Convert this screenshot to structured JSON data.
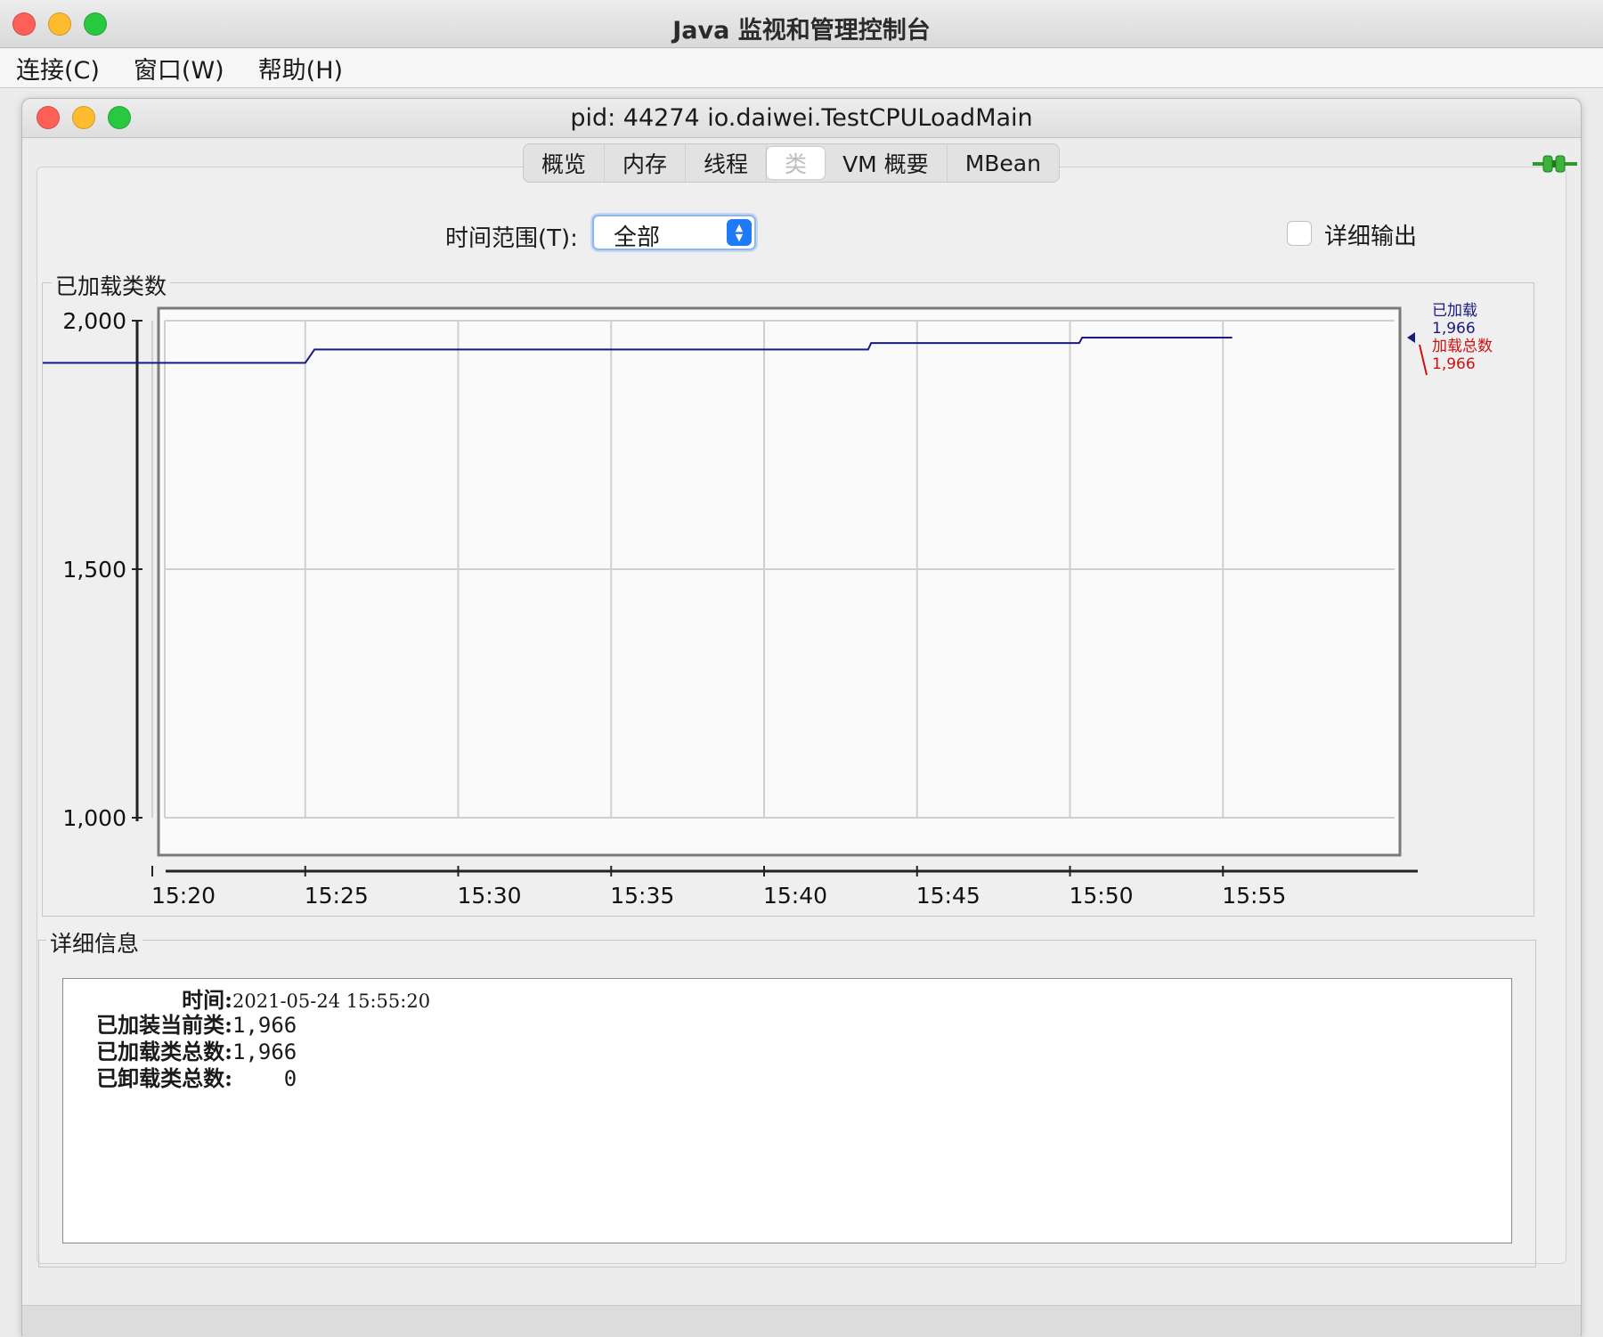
{
  "app": {
    "title": "Java 监视和管理控制台",
    "menu": [
      "连接(C)",
      "窗口(W)",
      "帮助(H)"
    ]
  },
  "window": {
    "title": "pid: 44274 io.daiwei.TestCPULoadMain",
    "tabs": [
      {
        "label": "概览",
        "active": false
      },
      {
        "label": "内存",
        "active": false
      },
      {
        "label": "线程",
        "active": false
      },
      {
        "label": "类",
        "active": true
      },
      {
        "label": "VM 概要",
        "active": false
      },
      {
        "label": "MBean",
        "active": false
      }
    ]
  },
  "controls": {
    "time_range_label": "时间范围(T):",
    "time_range_value": "全部",
    "verbose_label": "详细输出",
    "verbose_checked": false
  },
  "chart_panel": {
    "title": "已加载类数"
  },
  "chart_data": {
    "type": "line",
    "ylim": [
      1000,
      2000
    ],
    "y_ticks": [
      "2,000",
      "1,500",
      "1,000"
    ],
    "y_tick_values": [
      2000,
      1500,
      1000
    ],
    "x_ticks": [
      "15:20",
      "15:25",
      "15:30",
      "15:35",
      "15:40",
      "15:45",
      "15:50",
      "15:55"
    ],
    "x_tick_minutes": [
      20,
      25,
      30,
      35,
      40,
      45,
      50,
      55
    ],
    "series": [
      {
        "name": "已加载",
        "color": "#1a1a80",
        "points": [
          [
            15.1,
            1832
          ],
          [
            15.3,
            1850
          ],
          [
            15.3,
            1876
          ],
          [
            15.6,
            1880
          ],
          [
            15.8,
            1890
          ],
          [
            16.2,
            1915
          ],
          [
            25.0,
            1915
          ],
          [
            25.3,
            1942
          ],
          [
            43.4,
            1942
          ],
          [
            43.5,
            1955
          ],
          [
            50.3,
            1955
          ],
          [
            50.4,
            1966
          ],
          [
            55.3,
            1966
          ]
        ]
      }
    ],
    "legend": [
      {
        "label": "已加载",
        "value": "1,966",
        "color": "#1a1a80"
      },
      {
        "label": "加载总数",
        "value": "1,966",
        "color": "#cc1111"
      }
    ]
  },
  "detail_panel": {
    "title": "详细信息",
    "rows": [
      {
        "key": "时间:",
        "value": "2021-05-24 15:55:20"
      },
      {
        "key": "已加装当前类:",
        "value": "1,966"
      },
      {
        "key": "已加载类总数:",
        "value": "1,966"
      },
      {
        "key": "已卸载类总数:",
        "value": "    0"
      }
    ]
  }
}
